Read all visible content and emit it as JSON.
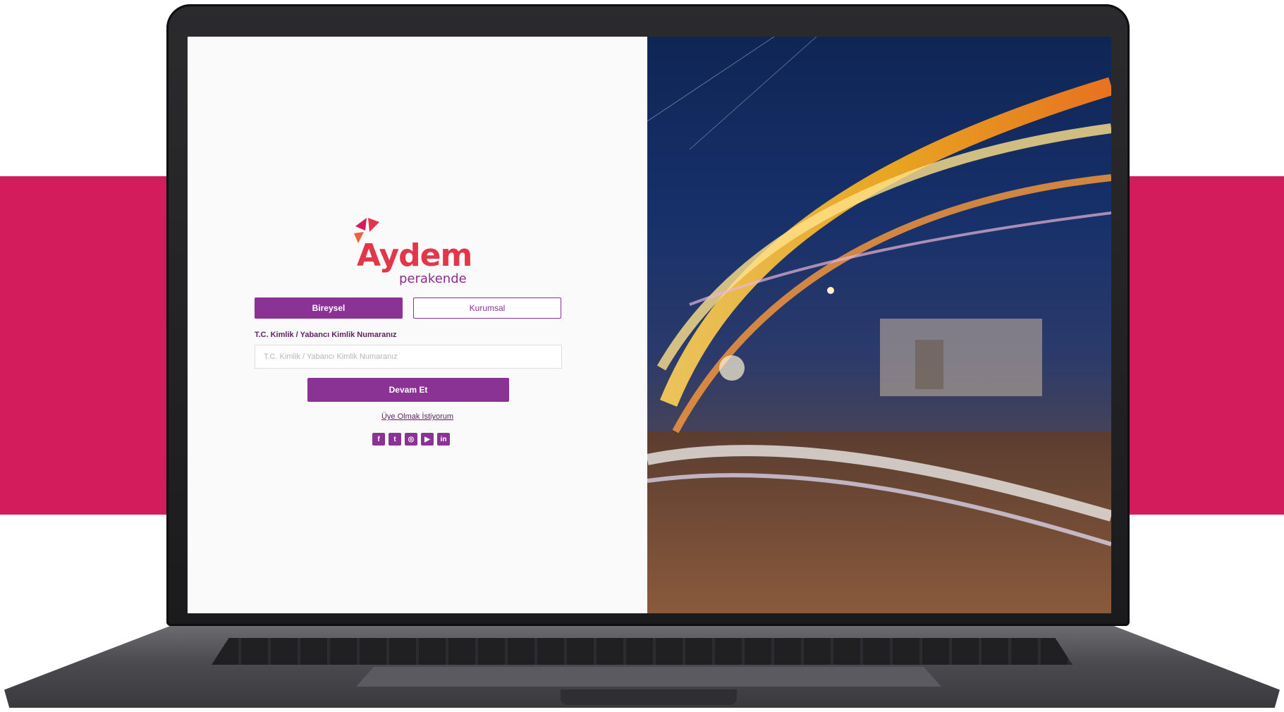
{
  "brand": {
    "wordmark": "Aydem",
    "sub": "perakende",
    "colors": {
      "band": "#d21c5b",
      "primary": "#8b3394",
      "logo": "#e2374b"
    }
  },
  "login": {
    "tabs": [
      {
        "label": "Bireysel",
        "active": true
      },
      {
        "label": "Kurumsal",
        "active": false
      }
    ],
    "id_label": "T.C. Kimlik / Yabancı Kimlik Numaranız",
    "id_placeholder": "T.C. Kimlik / Yabancı Kimlik Numaranız",
    "continue_label": "Devam Et",
    "signup_link": "Üye Olmak İstiyorum"
  },
  "socials": [
    {
      "icon": "facebook-icon",
      "glyph": "f"
    },
    {
      "icon": "twitter-icon",
      "glyph": "t"
    },
    {
      "icon": "instagram-icon",
      "glyph": "◎"
    },
    {
      "icon": "youtube-icon",
      "glyph": "▶"
    },
    {
      "icon": "linkedin-icon",
      "glyph": "in"
    }
  ]
}
